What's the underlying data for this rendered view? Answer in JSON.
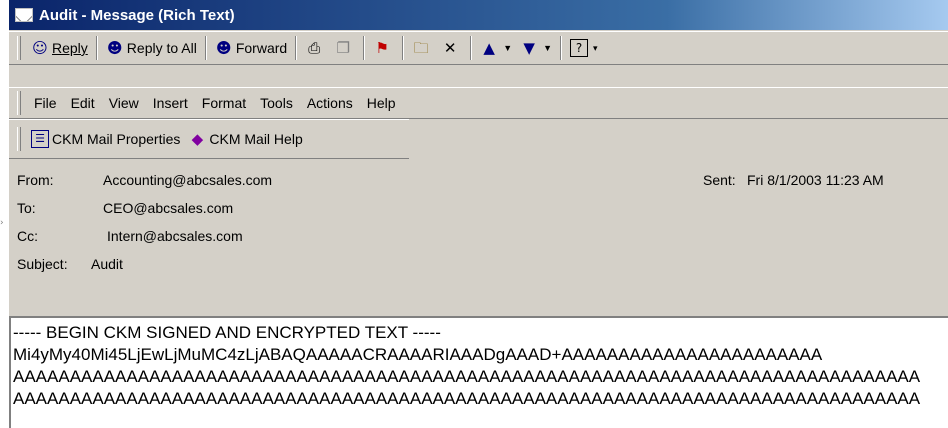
{
  "window": {
    "title": "Audit - Message (Rich Text)"
  },
  "toolbar": {
    "reply": "Reply",
    "reply_all": "Reply to All",
    "forward": "Forward"
  },
  "menu": [
    "File",
    "Edit",
    "View",
    "Insert",
    "Format",
    "Tools",
    "Actions",
    "Help"
  ],
  "ckm_toolbar": {
    "properties": "CKM Mail Properties",
    "help": "CKM Mail Help"
  },
  "header": {
    "from_label": "From:",
    "from": "Accounting@abcsales.com",
    "sent_label": "Sent:",
    "sent": "Fri 8/1/2003 11:23 AM",
    "to_label": "To:",
    "to": "CEO@abcsales.com",
    "cc_label": "Cc:",
    "cc": "Intern@abcsales.com",
    "subject_label": "Subject:",
    "subject": "Audit"
  },
  "body": {
    "lines": [
      "----- BEGIN CKM SIGNED AND ENCRYPTED TEXT -----",
      "Mi4yMy40Mi45LjEwLjMuMC4zLjABAQAAAAACRAAAARIAAADgAAAD+AAAAAAAAAAAAAAAAAAAAAAA",
      "AAAAAAAAAAAAAAAAAAAAAAAAAAAAAAAAAAAAAAAAAAAAAAAAAAAAAAAAAAAAAAAAAAAAAAAAAAAAAAAA",
      "AAAAAAAAAAAAAAAAAAAAAAAAAAAAAAAAAAAAAAAAAAAAAAAAAAAAAAAAAAAAAAAAAAAAAAAAAAAAAAAA"
    ]
  },
  "colors": {
    "titlebar": "#0a246a",
    "face": "#d4d0c8"
  }
}
